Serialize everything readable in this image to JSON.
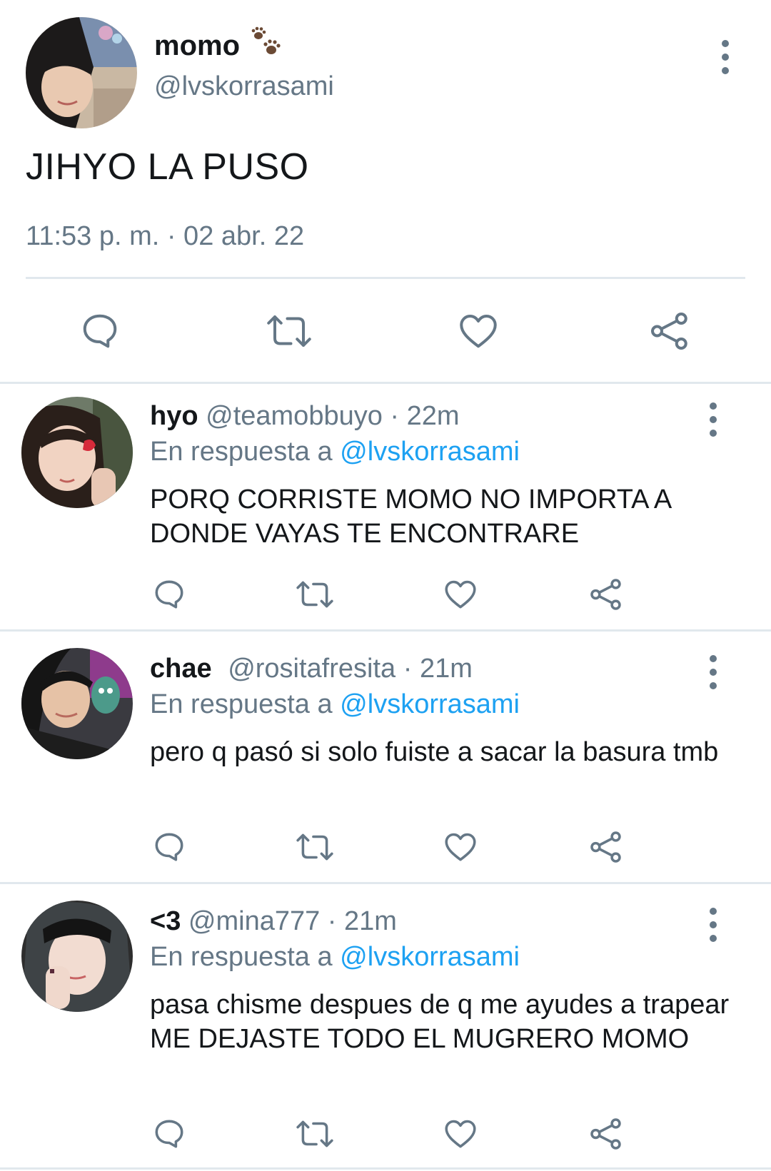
{
  "main_tweet": {
    "display_name": "momo",
    "name_emoji": "🐾",
    "handle": "@lvskorrasami",
    "text": "JIHYO LA PUSO",
    "timestamp": "11:53 p. m. · 02 abr. 22"
  },
  "replies": [
    {
      "display_name": "hyo",
      "handle": "@teamobbuyo",
      "time": " · 22m",
      "reply_prefix": "En respuesta a ",
      "reply_to": "@lvskorrasami",
      "text": "PORQ CORRISTE MOMO NO IMPORTA A DONDE VAYAS TE ENCONTRARE"
    },
    {
      "display_name": "chae",
      "handle": "@rositafresita",
      "time": " · 21m",
      "reply_prefix": "En respuesta a ",
      "reply_to": "@lvskorrasami",
      "text": "pero q pasó si solo fuiste a sacar la basura tmb"
    },
    {
      "display_name": "<3",
      "handle": "@mina777",
      "time": " · 21m",
      "reply_prefix": "En respuesta a ",
      "reply_to": "@lvskorrasami",
      "text": "pasa chisme despues de q me ayudes a trapear ME DEJASTE TODO EL MUGRERO MOMO"
    }
  ],
  "icons": {
    "more": "more-vertical-icon",
    "reply": "reply-bubble-icon",
    "retweet": "retweet-icon",
    "like": "heart-icon",
    "share": "share-icon"
  },
  "colors": {
    "text_primary": "#14171a",
    "text_secondary": "#657786",
    "mention": "#1da1f2",
    "divider": "#e1e8ed"
  }
}
